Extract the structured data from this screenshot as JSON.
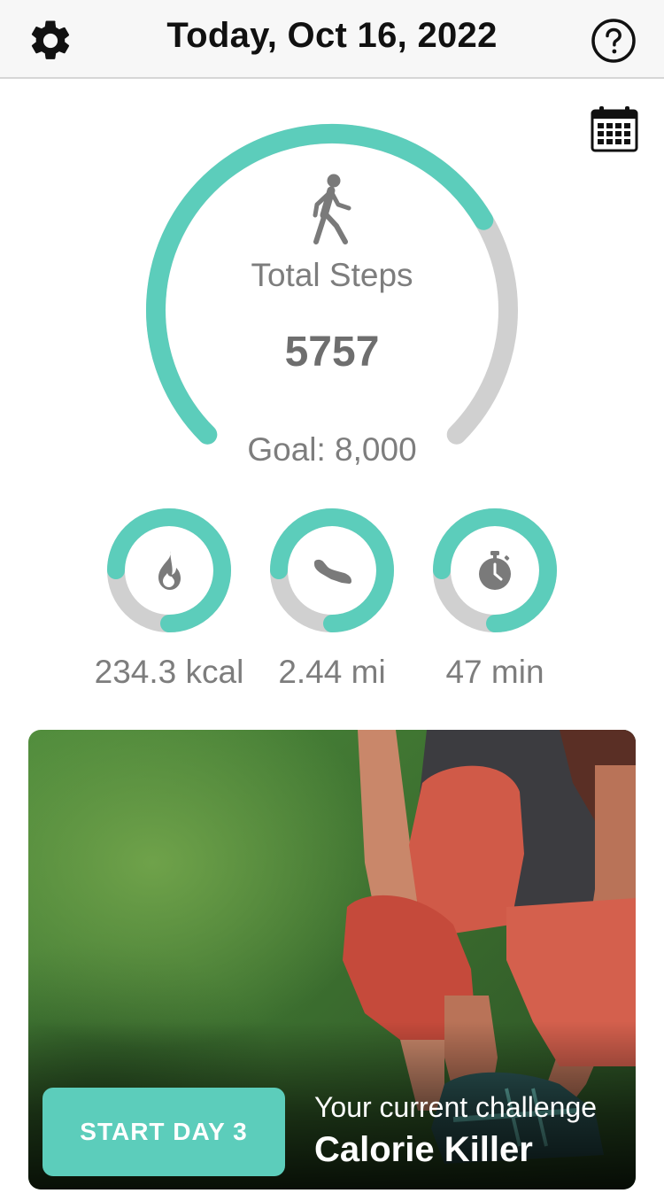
{
  "header": {
    "title": "Today, Oct 16, 2022",
    "settings_icon": "gear-icon",
    "help_icon": "question-circle-icon"
  },
  "calendar_icon": "calendar-icon",
  "steps": {
    "icon": "walking-person-icon",
    "label": "Total Steps",
    "value": "5757",
    "goal_text": "Goal: 8,000",
    "progress": 0.72
  },
  "stats": [
    {
      "icon": "flame-icon",
      "value": "234.3 kcal",
      "progress": 0.75
    },
    {
      "icon": "sneaker-icon",
      "value": "2.44 mi",
      "progress": 0.75
    },
    {
      "icon": "stopwatch-icon",
      "value": "47 min",
      "progress": 0.75
    }
  ],
  "challenge": {
    "button_label": "START DAY 3",
    "subtitle": "Your current challenge",
    "name": "Calorie Killer"
  },
  "colors": {
    "accent": "#5ccdbb",
    "track": "#d0d0d0",
    "muted_text": "#7d7d7d"
  }
}
